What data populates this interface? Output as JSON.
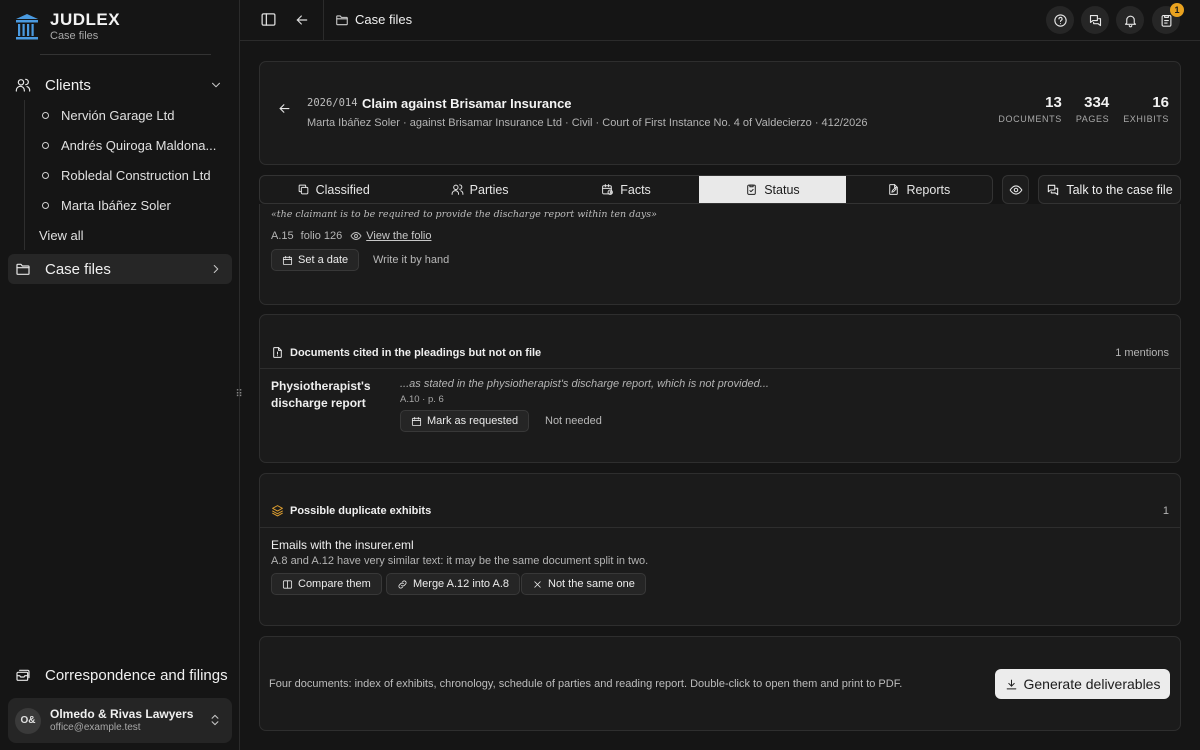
{
  "brand": {
    "name": "JUDLEX",
    "subtitle": "Case files"
  },
  "sidebar": {
    "clients_label": "Clients",
    "clients": [
      {
        "label": "Nervión Garage Ltd"
      },
      {
        "label": "Andrés Quiroga Maldona..."
      },
      {
        "label": "Robledal Construction Ltd"
      },
      {
        "label": "Marta Ibáñez Soler"
      }
    ],
    "view_all": "View all",
    "case_files_label": "Case files",
    "correspondence_label": "Correspondence and filings",
    "user": {
      "initials": "O&",
      "name": "Olmedo & Rivas Lawyers",
      "email": "office@example.test"
    }
  },
  "topbar": {
    "breadcrumb": "Case files",
    "notification_count": "1"
  },
  "case": {
    "id": "2026/014",
    "title": "Claim against Brisamar Insurance",
    "subtitle": "Marta Ibáñez Soler · against Brisamar Insurance Ltd · Civil · Court of First Instance No. 4 of Valdecierzo · 412/2026",
    "stats": [
      {
        "value": "13",
        "label": "DOCUMENTS"
      },
      {
        "value": "334",
        "label": "PAGES"
      },
      {
        "value": "16",
        "label": "EXHIBITS"
      }
    ]
  },
  "tabs": [
    {
      "label": "Classified",
      "icon": "copy-icon"
    },
    {
      "label": "Parties",
      "icon": "users-icon"
    },
    {
      "label": "Facts",
      "icon": "calendar-clock-icon"
    },
    {
      "label": "Status",
      "icon": "clipboard-check-icon",
      "active": true
    },
    {
      "label": "Reports",
      "icon": "file-edit-icon"
    }
  ],
  "talk_button": "Talk to the case file",
  "status_item": {
    "quote": "«the claimant is to be required to provide the discharge report within ten days»",
    "ref": "A.15",
    "folio": "folio 126",
    "view_folio": "View the folio",
    "set_date": "Set a date",
    "write_by_hand": "Write it by hand"
  },
  "cited_card": {
    "title": "Documents cited in the pleadings but not on file",
    "count": "1 mentions",
    "doc_name": "Physiotherapist's discharge report",
    "quote": "...as stated in the physiotherapist's discharge report, which is not provided...",
    "ref": "A.10 · p. 6",
    "mark_requested": "Mark as requested",
    "not_needed": "Not needed"
  },
  "dup_card": {
    "title": "Possible duplicate exhibits",
    "count": "1",
    "item_title": "Emails with the insurer.eml",
    "item_desc": "A.8 and A.12 have very similar text: it may be the same document split in two.",
    "compare": "Compare them",
    "merge": "Merge A.12 into A.8",
    "not_same": "Not the same one"
  },
  "deliver": {
    "text": "Four documents: index of exhibits, chronology, schedule of parties and reading report. Double-click to open them and print to PDF.",
    "button": "Generate deliverables"
  },
  "colors": {
    "accent_logo": "#4a9ae0",
    "badge": "#e9a21f",
    "duplicate_icon": "#e0a030"
  }
}
